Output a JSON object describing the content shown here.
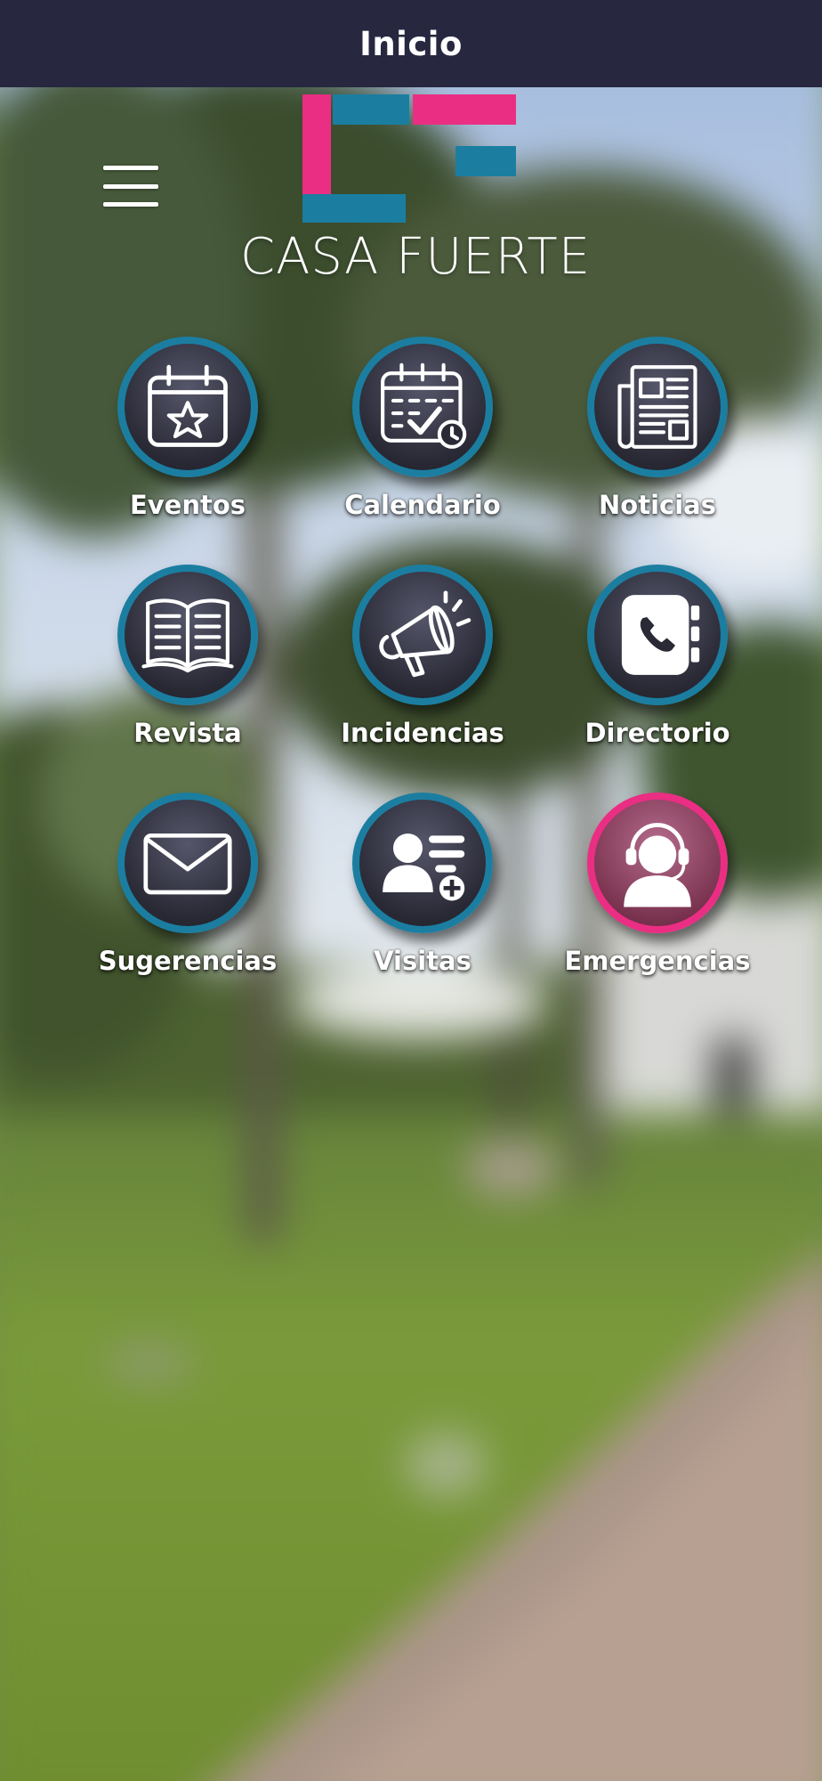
{
  "header": {
    "title": "Inicio"
  },
  "menu": {
    "icon": "hamburger-menu-icon"
  },
  "brand": {
    "name": "CASA FUERTE",
    "colors": {
      "pink": "#ea2e83",
      "blue": "#1b7ea1",
      "header": "#272740"
    }
  },
  "tiles": [
    {
      "label": "Eventos",
      "icon": "calendar-star-icon"
    },
    {
      "label": "Calendario",
      "icon": "calendar-check-icon"
    },
    {
      "label": "Noticias",
      "icon": "newspaper-icon"
    },
    {
      "label": "Revista",
      "icon": "open-book-icon"
    },
    {
      "label": "Incidencias",
      "icon": "megaphone-icon"
    },
    {
      "label": "Directorio",
      "icon": "phone-book-icon"
    },
    {
      "label": "Sugerencias",
      "icon": "envelope-icon"
    },
    {
      "label": "Visitas",
      "icon": "add-visitor-icon"
    },
    {
      "label": "Emergencias",
      "icon": "headset-agent-icon"
    }
  ]
}
